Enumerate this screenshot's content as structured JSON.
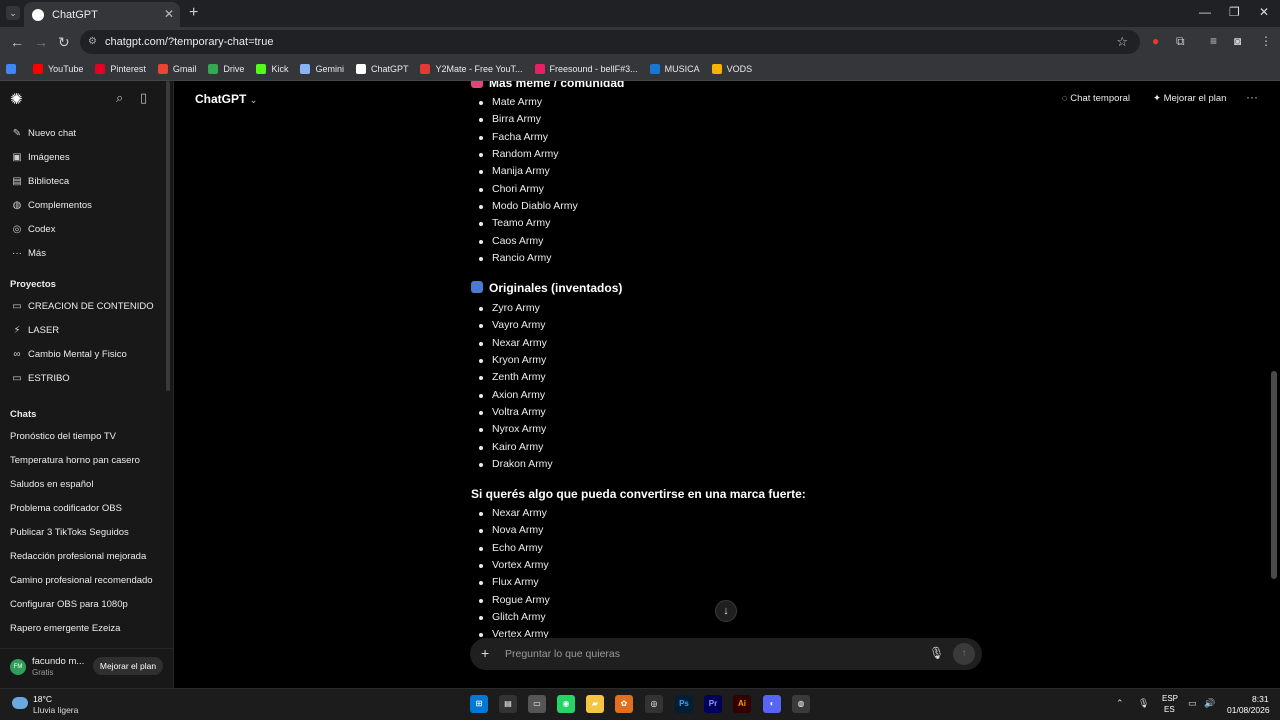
{
  "browser": {
    "tab_title": "ChatGPT",
    "url": "chatgpt.com/?temporary-chat=true",
    "bookmarks": [
      {
        "label": "",
        "color": "#4285f4"
      },
      {
        "label": "YouTube",
        "color": "#ff0000"
      },
      {
        "label": "Pinterest",
        "color": "#e60023"
      },
      {
        "label": "Gmail",
        "color": "#ea4335"
      },
      {
        "label": "Drive",
        "color": "#34a853"
      },
      {
        "label": "Kick",
        "color": "#53fc18"
      },
      {
        "label": "Gemini",
        "color": "#8ab4f8"
      },
      {
        "label": "ChatGPT",
        "color": "#ffffff"
      },
      {
        "label": "Y2Mate - Free YouT...",
        "color": "#e53935"
      },
      {
        "label": "Freesound - bellF#3...",
        "color": "#e91e63"
      },
      {
        "label": "MUSICA",
        "color": "#1976d2"
      },
      {
        "label": "VODS",
        "color": "#f4b400"
      }
    ]
  },
  "sidebar": {
    "nav": [
      {
        "icon": "✎",
        "label": "Nuevo chat"
      },
      {
        "icon": "▣",
        "label": "Imágenes"
      },
      {
        "icon": "▤",
        "label": "Biblioteca"
      },
      {
        "icon": "◍",
        "label": "Complementos"
      },
      {
        "icon": "◎",
        "label": "Codex"
      },
      {
        "icon": "···",
        "label": "Más"
      }
    ],
    "projects_heading": "Proyectos",
    "projects": [
      {
        "icon": "▭",
        "label": "CREACION DE CONTENIDO"
      },
      {
        "icon": "⚡",
        "label": "LASER"
      },
      {
        "icon": "∞",
        "label": "Cambio Mental y Fisico"
      },
      {
        "icon": "▭",
        "label": "ESTRIBO"
      }
    ],
    "chats_heading": "Chats",
    "chats": [
      "Pronóstico del tiempo TV",
      "Temperatura horno pan casero",
      "Saludos en español",
      "Problema codificador OBS",
      "Publicar 3 TikToks Seguidos",
      "Redacción profesional mejorada",
      "Camino profesional recomendado",
      "Configurar OBS para 1080p",
      "Rapero emergente Ezeiza"
    ],
    "user": {
      "initials": "FM",
      "name": "facundo m...",
      "plan": "Gratis",
      "upgrade_label": "Mejorar el plan"
    }
  },
  "header": {
    "model": "ChatGPT",
    "temp_chat": "Chat temporal",
    "upgrade": "Mejorar el plan"
  },
  "content": {
    "section1_title": "Más meme / comunidad",
    "section1_items": [
      "Mate Army",
      "Birra Army",
      "Facha Army",
      "Random Army",
      "Manija Army",
      "Chori Army",
      "Modo Diablo Army",
      "Teamo Army",
      "Caos Army",
      "Rancio Army"
    ],
    "section2_title": "Originales (inventados)",
    "section2_items": [
      "Zyro Army",
      "Vayro Army",
      "Nexar Army",
      "Kryon Army",
      "Zenth Army",
      "Axion Army",
      "Voltra Army",
      "Nyrox Army",
      "Kairo Army",
      "Drakon Army"
    ],
    "section3_title": "Si querés algo que pueda convertirse en una marca fuerte:",
    "section3_items": [
      "Nexar Army",
      "Nova Army",
      "Echo Army",
      "Vortex Army",
      "Flux Army",
      "Rogue Army",
      "Glitch Army",
      "Vertex Army"
    ]
  },
  "composer": {
    "placeholder": "Preguntar lo que quieras"
  },
  "taskbar": {
    "temperature": "18°C",
    "weather": "Lluvia ligera",
    "lang": "ESP",
    "lang_sub": "ES",
    "time": "8:31",
    "date": "01/08/2026"
  }
}
